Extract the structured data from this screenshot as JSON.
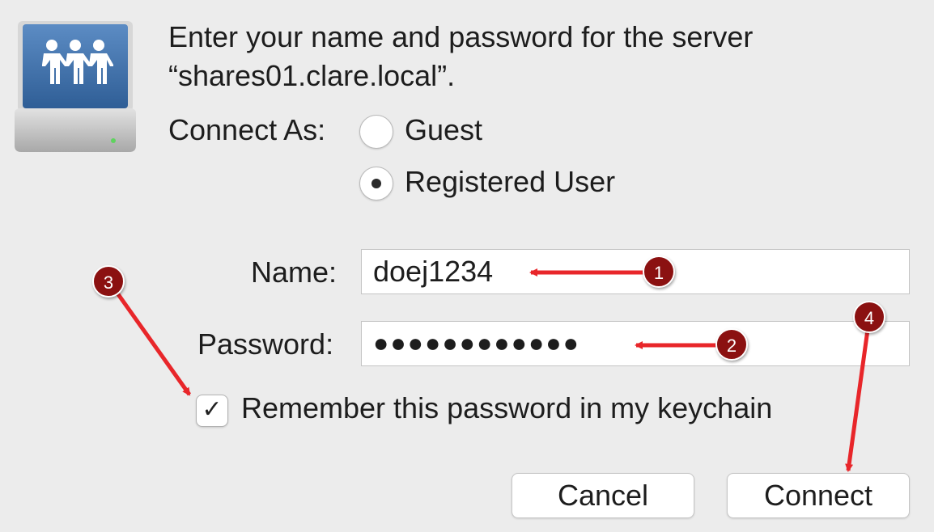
{
  "dialog": {
    "prompt_line1": "Enter your name and password for the server",
    "prompt_line2": "“shares01.clare.local”.",
    "connect_as_label": "Connect As:",
    "radio_options": [
      {
        "label": "Guest",
        "selected": false
      },
      {
        "label": "Registered User",
        "selected": true
      }
    ],
    "name_label": "Name:",
    "name_value": "doej1234",
    "password_label": "Password:",
    "password_value": "●●●●●●●●●●●●",
    "remember_label": "Remember this password in my keychain",
    "remember_checked": true,
    "remember_checkmark": "✓",
    "cancel_label": "Cancel",
    "connect_label": "Connect"
  },
  "callouts": [
    {
      "number": "1",
      "target": "name-field"
    },
    {
      "number": "2",
      "target": "password-field"
    },
    {
      "number": "3",
      "target": "remember-checkbox"
    },
    {
      "number": "4",
      "target": "connect-button"
    }
  ],
  "colors": {
    "background": "#ececec",
    "callout": "#8b1111",
    "arrow": "#e8262a",
    "icon_blue": "#3d6fa8"
  },
  "icons": {
    "server": "shared-server-icon"
  }
}
